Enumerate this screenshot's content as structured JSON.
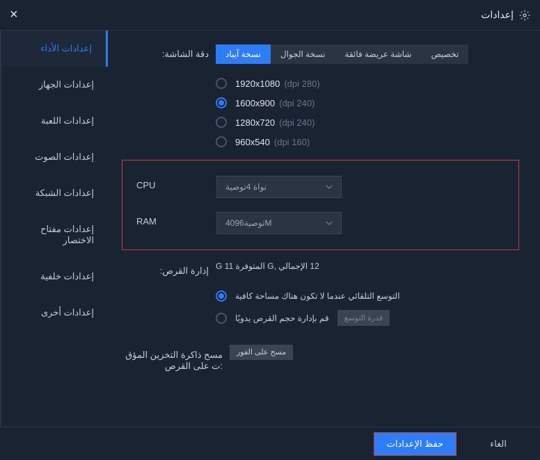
{
  "header": {
    "title": "إعدادات"
  },
  "sidebar": {
    "items": [
      {
        "label": "إعدادات الأداء"
      },
      {
        "label": "إعدادات الجهاز"
      },
      {
        "label": "إعدادات اللعبة"
      },
      {
        "label": "إعدادات الصوت"
      },
      {
        "label": "إعدادات الشبكة"
      },
      {
        "label": "إعدادات مفتاح الاختصار"
      },
      {
        "label": "إعدادات خلفية"
      },
      {
        "label": "إعدادات أخرى"
      }
    ]
  },
  "resolution": {
    "label": ":دقة الشاشة",
    "tabs": [
      {
        "label": "نسخة آيباد"
      },
      {
        "label": "نسخة الجوال"
      },
      {
        "label": "شاشة عريضة فائقة"
      },
      {
        "label": "تخصيص"
      }
    ],
    "options": [
      {
        "res": "1920x1080",
        "dpi": "(dpi 280)"
      },
      {
        "res": "1600x900",
        "dpi": "(dpi 240)"
      },
      {
        "res": "1280x720",
        "dpi": "(dpi 240)"
      },
      {
        "res": "960x540",
        "dpi": "(dpi 160)"
      }
    ]
  },
  "cpu": {
    "label": "CPU",
    "value": "نواة 4توصية"
  },
  "ram": {
    "label": "RAM",
    "value": "توصية4096M"
  },
  "disk": {
    "label": ":إدارة القرص",
    "info": "12 الإجمالي ,G المتوفرة 11 G",
    "opt_auto": "التوسع التلقائي عندما لا تكون هناك مساحة كافية",
    "opt_manual": "قم بإدارة حجم القرص يدويًا",
    "btn_expand": "قدرة التوسع"
  },
  "cache": {
    "label": "مسح ذاكرة التخزين المؤق :ت على القرص",
    "btn": "مسح على الفور"
  },
  "footer": {
    "save": "حفظ الإعدادات",
    "cancel": "الغاء"
  }
}
